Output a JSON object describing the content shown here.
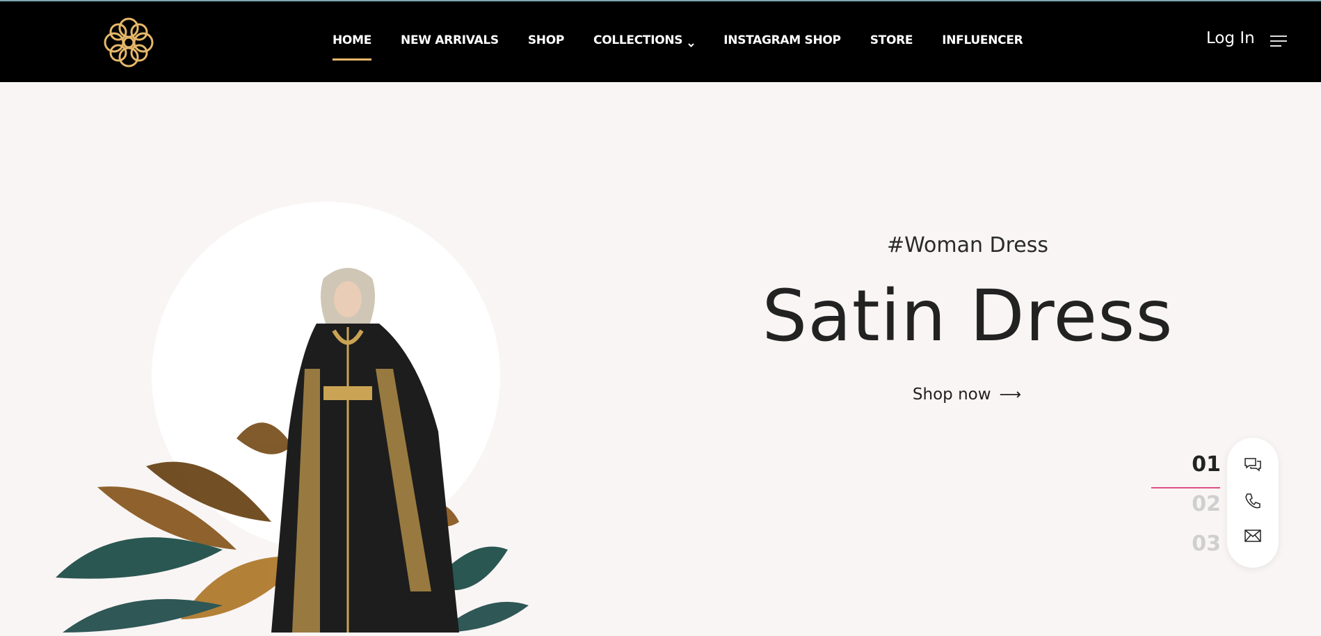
{
  "header": {
    "logo_icon": "gold-knot-logo",
    "nav": [
      {
        "label": "HOME",
        "active": true
      },
      {
        "label": "NEW ARRIVALS"
      },
      {
        "label": "SHOP"
      },
      {
        "label": "COLLECTIONS",
        "has_dropdown": true
      },
      {
        "label": "INSTAGRAM SHOP"
      },
      {
        "label": "STORE"
      },
      {
        "label": "INFLUENCER"
      }
    ],
    "login_label": "Log In",
    "menu_icon": "hamburger-icon"
  },
  "hero": {
    "tag": "#Woman Dress",
    "title": "Satin Dress",
    "cta_label": "Shop now",
    "cta_icon": "arrow-right-icon"
  },
  "slider": {
    "items": [
      "01",
      "02",
      "03"
    ],
    "active_index": 0
  },
  "contact": {
    "icons": [
      "chat-icon",
      "phone-icon",
      "mail-icon"
    ]
  },
  "colors": {
    "header_bg": "#000000",
    "accent_gold": "#e6b86a",
    "page_bg": "#f9f5f4",
    "slider_line": "#e04f86"
  }
}
